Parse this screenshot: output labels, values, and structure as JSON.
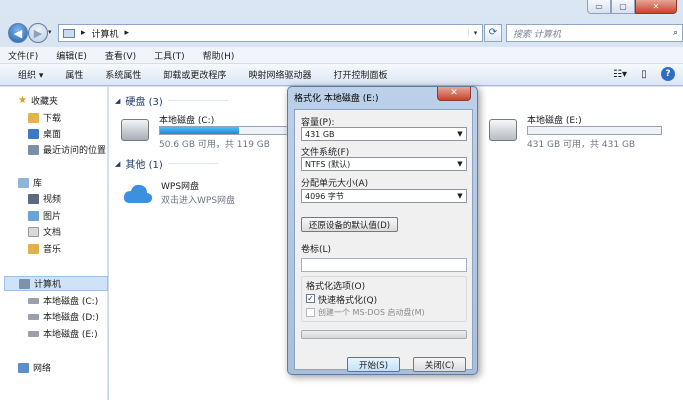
{
  "caption": {
    "minimize": "▭",
    "maximize": "▢",
    "close": "✕"
  },
  "address": {
    "separator": "▸",
    "path": "计算机",
    "after": "▸"
  },
  "search": {
    "placeholder": "搜索 计算机"
  },
  "menu": [
    "文件(F)",
    "编辑(E)",
    "查看(V)",
    "工具(T)",
    "帮助(H)"
  ],
  "toolbar": [
    "组织 ▾",
    "属性",
    "系统属性",
    "卸载或更改程序",
    "映射网络驱动器",
    "打开控制面板"
  ],
  "sidebar": {
    "favorites": "收藏夹",
    "download": "下载",
    "desktop": "桌面",
    "recent": "最近访问的位置",
    "libraries": "库",
    "video": "视频",
    "pictures": "图片",
    "docs": "文档",
    "music": "音乐",
    "computer": "计算机",
    "c": "本地磁盘 (C:)",
    "d": "本地磁盘 (D:)",
    "e": "本地磁盘 (E:)",
    "network": "网络"
  },
  "main": {
    "hdd_group": "硬盘 (3)",
    "other_group": "其他 (1)",
    "drive_c": {
      "name": "本地磁盘 (C:)",
      "size": "50.6 GB 可用，共 119 GB",
      "used_fraction": 0.575
    },
    "drive_e": {
      "name": "本地磁盘 (E:)",
      "size": "431 GB 可用，共 431 GB",
      "used_fraction": 0.0
    },
    "wps": {
      "name": "WPS网盘",
      "desc": "双击进入WPS网盘"
    }
  },
  "dialog": {
    "title": "格式化 本地磁盘 (E:)",
    "close": "✕",
    "capacity_label": "容量(P):",
    "capacity_value": "431 GB",
    "fs_label": "文件系统(F)",
    "fs_value": "NTFS (默认)",
    "alloc_label": "分配单元大小(A)",
    "alloc_value": "4096 字节",
    "restore_btn": "还原设备的默认值(D)",
    "volume_label": "卷标(L)",
    "options_label": "格式化选项(O)",
    "quick_format": "快速格式化(Q)",
    "msdos": "创建一个 MS-DOS 启动盘(M)",
    "start_btn": "开始(S)",
    "close_btn": "关闭(C)"
  },
  "colors": {
    "accent": "#1e8ccf",
    "close": "#c7432b"
  }
}
